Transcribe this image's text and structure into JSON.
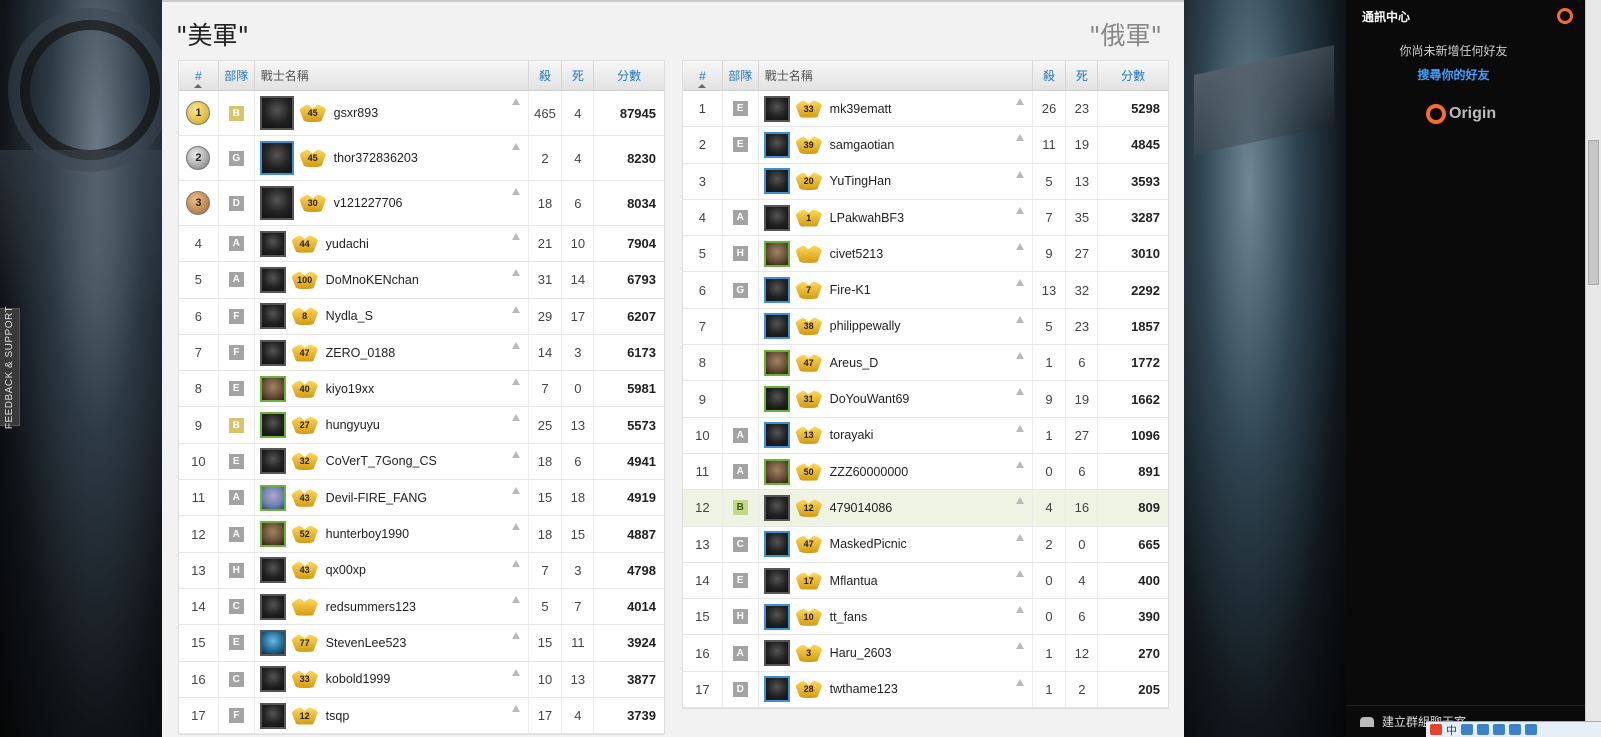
{
  "feedback_label": "FEEDBACK & SUPPORT",
  "teams": {
    "us": {
      "name": "\"美軍\""
    },
    "ru": {
      "name": "\"俄軍\""
    }
  },
  "columns": {
    "rank": "#",
    "squad": "部隊",
    "name": "戰士名稱",
    "kills": "殺",
    "deaths": "死",
    "score": "分數"
  },
  "us_players": [
    {
      "rank": "1",
      "squad": "B",
      "name": "gsxr893",
      "icon": "45",
      "kills": "465",
      "deaths": "4",
      "score": "87945"
    },
    {
      "rank": "2",
      "squad": "G",
      "name": "thor372836203",
      "icon": "45",
      "kills": "2",
      "deaths": "4",
      "score": "8230"
    },
    {
      "rank": "3",
      "squad": "D",
      "name": "v121227706",
      "icon": "30",
      "kills": "18",
      "deaths": "6",
      "score": "8034"
    },
    {
      "rank": "4",
      "squad": "A",
      "name": "yudachi",
      "icon": "44",
      "kills": "21",
      "deaths": "10",
      "score": "7904"
    },
    {
      "rank": "5",
      "squad": "A",
      "name": "DoMnoKENchan",
      "icon": "100",
      "kills": "31",
      "deaths": "14",
      "score": "6793"
    },
    {
      "rank": "6",
      "squad": "F",
      "name": "Nydla_S",
      "icon": "8",
      "kills": "29",
      "deaths": "17",
      "score": "6207"
    },
    {
      "rank": "7",
      "squad": "F",
      "name": "ZERO_0188",
      "icon": "47",
      "kills": "14",
      "deaths": "3",
      "score": "6173"
    },
    {
      "rank": "8",
      "squad": "E",
      "name": "kiyo19xx",
      "icon": "40",
      "kills": "7",
      "deaths": "0",
      "score": "5981"
    },
    {
      "rank": "9",
      "squad": "B",
      "name": "hungyuyu",
      "icon": "27",
      "kills": "25",
      "deaths": "13",
      "score": "5573"
    },
    {
      "rank": "10",
      "squad": "E",
      "name": "CoVerT_7Gong_CS",
      "icon": "32",
      "kills": "18",
      "deaths": "6",
      "score": "4941"
    },
    {
      "rank": "11",
      "squad": "A",
      "name": "Devil-FIRE_FANG",
      "icon": "43",
      "kills": "15",
      "deaths": "18",
      "score": "4919"
    },
    {
      "rank": "12",
      "squad": "A",
      "name": "hunterboy1990",
      "icon": "52",
      "kills": "18",
      "deaths": "15",
      "score": "4887"
    },
    {
      "rank": "13",
      "squad": "H",
      "name": "qx00xp",
      "icon": "43",
      "kills": "7",
      "deaths": "3",
      "score": "4798"
    },
    {
      "rank": "14",
      "squad": "C",
      "name": "redsummers123",
      "icon": "",
      "kills": "5",
      "deaths": "7",
      "score": "4014"
    },
    {
      "rank": "15",
      "squad": "E",
      "name": "StevenLee523",
      "icon": "77",
      "kills": "15",
      "deaths": "11",
      "score": "3924"
    },
    {
      "rank": "16",
      "squad": "C",
      "name": "kobold1999",
      "icon": "33",
      "kills": "10",
      "deaths": "13",
      "score": "3877"
    },
    {
      "rank": "17",
      "squad": "F",
      "name": "tsqp",
      "icon": "12",
      "kills": "17",
      "deaths": "4",
      "score": "3739"
    }
  ],
  "ru_players": [
    {
      "rank": "1",
      "squad": "E",
      "name": "mk39ematt",
      "icon": "33",
      "kills": "26",
      "deaths": "23",
      "score": "5298"
    },
    {
      "rank": "2",
      "squad": "E",
      "name": "samgaotian",
      "icon": "39",
      "kills": "11",
      "deaths": "19",
      "score": "4845"
    },
    {
      "rank": "3",
      "squad": "",
      "name": "YuTingHan",
      "icon": "20",
      "kills": "5",
      "deaths": "13",
      "score": "3593"
    },
    {
      "rank": "4",
      "squad": "A",
      "name": "LPakwahBF3",
      "icon": "1",
      "kills": "7",
      "deaths": "35",
      "score": "3287"
    },
    {
      "rank": "5",
      "squad": "H",
      "name": "civet5213",
      "icon": "",
      "kills": "9",
      "deaths": "27",
      "score": "3010"
    },
    {
      "rank": "6",
      "squad": "G",
      "name": "Fire-K1",
      "icon": "7",
      "kills": "13",
      "deaths": "32",
      "score": "2292"
    },
    {
      "rank": "7",
      "squad": "",
      "name": "philippewally",
      "icon": "38",
      "kills": "5",
      "deaths": "23",
      "score": "1857"
    },
    {
      "rank": "8",
      "squad": "",
      "name": "Areus_D",
      "icon": "47",
      "kills": "1",
      "deaths": "6",
      "score": "1772"
    },
    {
      "rank": "9",
      "squad": "",
      "name": "DoYouWant69",
      "icon": "31",
      "kills": "9",
      "deaths": "19",
      "score": "1662"
    },
    {
      "rank": "10",
      "squad": "A",
      "name": "torayaki",
      "icon": "13",
      "kills": "1",
      "deaths": "27",
      "score": "1096"
    },
    {
      "rank": "11",
      "squad": "A",
      "name": "ZZZ60000000",
      "icon": "50",
      "kills": "0",
      "deaths": "6",
      "score": "891"
    },
    {
      "rank": "12",
      "squad": "B",
      "name": "479014086",
      "icon": "12",
      "kills": "4",
      "deaths": "16",
      "score": "809"
    },
    {
      "rank": "13",
      "squad": "C",
      "name": "MaskedPicnic",
      "icon": "47",
      "kills": "2",
      "deaths": "0",
      "score": "665"
    },
    {
      "rank": "14",
      "squad": "E",
      "name": "Mflantua",
      "icon": "17",
      "kills": "0",
      "deaths": "4",
      "score": "400"
    },
    {
      "rank": "15",
      "squad": "H",
      "name": "tt_fans",
      "icon": "10",
      "kills": "0",
      "deaths": "6",
      "score": "390"
    },
    {
      "rank": "16",
      "squad": "A",
      "name": "Haru_2603",
      "icon": "3",
      "kills": "1",
      "deaths": "12",
      "score": "270"
    },
    {
      "rank": "17",
      "squad": "D",
      "name": "twthame123",
      "icon": "28",
      "kills": "1",
      "deaths": "2",
      "score": "205"
    }
  ],
  "panel": {
    "title": "通訊中心",
    "no_friends": "你尚未新增任何好友",
    "find_friends": "搜尋你的好友",
    "origin_label": "Origin",
    "footer": "建立群組聊天室"
  },
  "tray": {
    "ime": "中"
  },
  "colors": {
    "link": "#1e78c8",
    "origin": "#f56c2d",
    "highlight_row": "#eef3e3"
  }
}
